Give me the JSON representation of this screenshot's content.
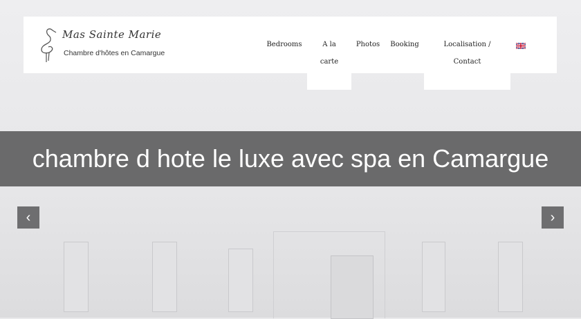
{
  "logo": {
    "name": "Mas Sainte Marie",
    "tagline": "Chambre d'hôtes en Camargue",
    "icon": "flamingo-icon"
  },
  "nav": {
    "items": [
      {
        "label": "Bedrooms"
      },
      {
        "label_line1": "A la",
        "label_line2": "carte"
      },
      {
        "label": "Photos"
      },
      {
        "label": "Booking"
      },
      {
        "label_line1": "Localisation /",
        "label_line2": "Contact"
      }
    ],
    "language_flag": "uk-flag-icon"
  },
  "banner": {
    "title": "chambre d hote le luxe avec spa en Camargue"
  },
  "slider": {
    "prev_icon": "chevron-left-icon",
    "next_icon": "chevron-right-icon",
    "prev_glyph": "‹",
    "next_glyph": "›"
  },
  "colors": {
    "banner_bg": "#6a6a6b",
    "header_bg": "#ffffff",
    "page_bg": "#e9e9eb",
    "slider_button_bg": "#6e6e70"
  }
}
